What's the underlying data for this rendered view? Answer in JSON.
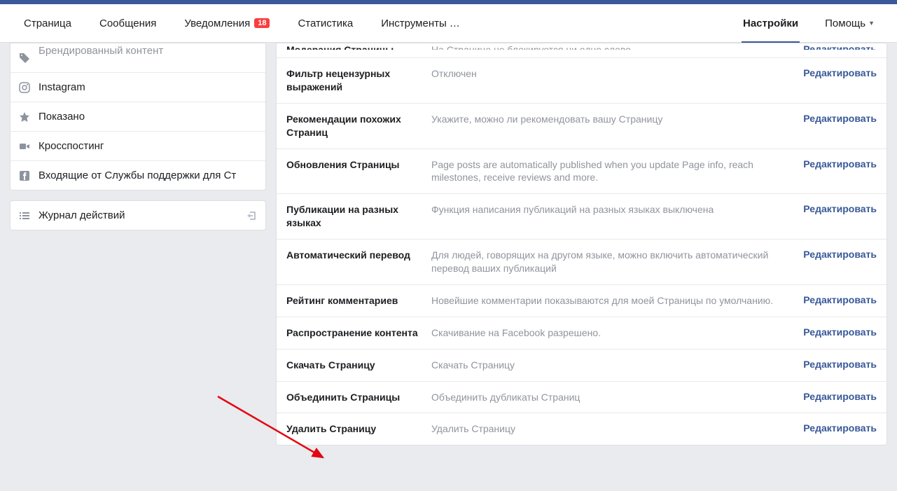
{
  "nav": {
    "items": [
      {
        "label": "Страница"
      },
      {
        "label": "Сообщения"
      },
      {
        "label": "Уведомления",
        "badge": "18"
      },
      {
        "label": "Статистика"
      },
      {
        "label": "Инструменты …"
      }
    ],
    "active": {
      "label": "Настройки"
    },
    "help": {
      "label": "Помощь"
    }
  },
  "sidebar": {
    "items": [
      {
        "label": "Брендированный контент"
      },
      {
        "label": "Instagram"
      },
      {
        "label": "Показано"
      },
      {
        "label": "Кросспостинг"
      },
      {
        "label": "Входящие от Службы поддержки для Ст"
      }
    ],
    "journal": {
      "label": "Журнал действий"
    }
  },
  "settings": {
    "edit_label": "Редактировать",
    "rows": [
      {
        "title": "Модерация Страницы",
        "desc": "На Странице не блокируется ни одно слово."
      },
      {
        "title": "Фильтр нецензурных выражений",
        "desc": "Отключен"
      },
      {
        "title": "Рекомендации похожих Страниц",
        "desc": "Укажите, можно ли рекомендовать вашу Страницу"
      },
      {
        "title": "Обновления Страницы",
        "desc": "Page posts are automatically published when you update Page info, reach milestones, receive reviews and more."
      },
      {
        "title": "Публикации на разных языках",
        "desc": "Функция написания публикаций на разных языках выключена"
      },
      {
        "title": "Автоматический перевод",
        "desc": "Для людей, говорящих на другом языке, можно включить автоматический перевод ваших публикаций"
      },
      {
        "title": "Рейтинг комментариев",
        "desc": "Новейшие комментарии показываются для моей Страницы по умолчанию."
      },
      {
        "title": "Распространение контента",
        "desc": "Скачивание на Facebook разрешено."
      },
      {
        "title": "Скачать Страницу",
        "desc": "Скачать Страницу"
      },
      {
        "title": "Объединить Страницы",
        "desc": "Объединить дубликаты Страниц"
      },
      {
        "title": "Удалить Страницу",
        "desc": "Удалить Страницу"
      }
    ]
  }
}
